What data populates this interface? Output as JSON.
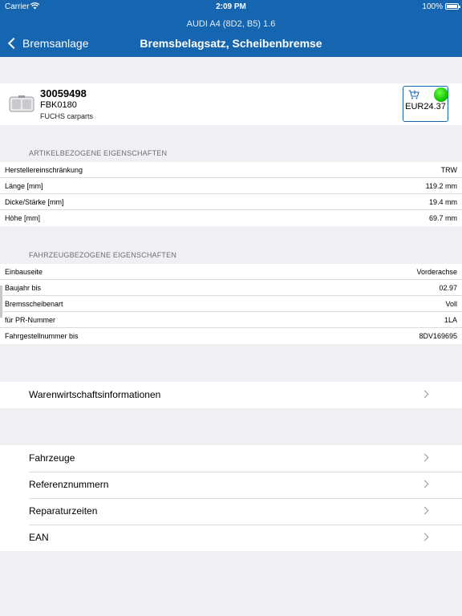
{
  "status_bar": {
    "carrier": "Carrier",
    "time": "2:09 PM",
    "battery": "100%"
  },
  "nav": {
    "vehicle": "AUDI A4 (8D2, B5) 1.6",
    "back_label": "Bremsanlage",
    "title": "Bremsbelagsatz, Scheibenbremse"
  },
  "article": {
    "number": "30059498",
    "code": "FBK0180",
    "supplier": "FUCHS carparts",
    "price": "EUR24.37",
    "availability_color": "#14c400"
  },
  "article_properties": {
    "header": "ARTIKELBEZOGENE EIGENSCHAFTEN",
    "rows": [
      {
        "key": "Herstellereinschränkung",
        "value": "TRW"
      },
      {
        "key": "Länge [mm]",
        "value": "119.2 mm"
      },
      {
        "key": "Dicke/Stärke [mm]",
        "value": "19.4 mm"
      },
      {
        "key": "Höhe [mm]",
        "value": "69.7 mm"
      }
    ]
  },
  "vehicle_properties": {
    "header": "FAHRZEUGBEZOGENE EIGENSCHAFTEN",
    "rows": [
      {
        "key": "Einbauseite",
        "value": "Vorderachse"
      },
      {
        "key": "Baujahr bis",
        "value": "02.97"
      },
      {
        "key": "Bremsscheibenart",
        "value": "Voll"
      },
      {
        "key": "für PR-Nummer",
        "value": "1LA"
      },
      {
        "key": "Fahrgestellnummer bis",
        "value": "8DV169695"
      }
    ]
  },
  "menu_1": {
    "items": [
      {
        "label": "Warenwirtschaftsinformationen"
      }
    ]
  },
  "menu_2": {
    "items": [
      {
        "label": "Fahrzeuge"
      },
      {
        "label": "Referenznummern"
      },
      {
        "label": "Reparaturzeiten"
      },
      {
        "label": "EAN"
      }
    ]
  },
  "colors": {
    "nav_bar": "#1565b0",
    "background": "#efeff4",
    "accent": "#1565b0"
  }
}
